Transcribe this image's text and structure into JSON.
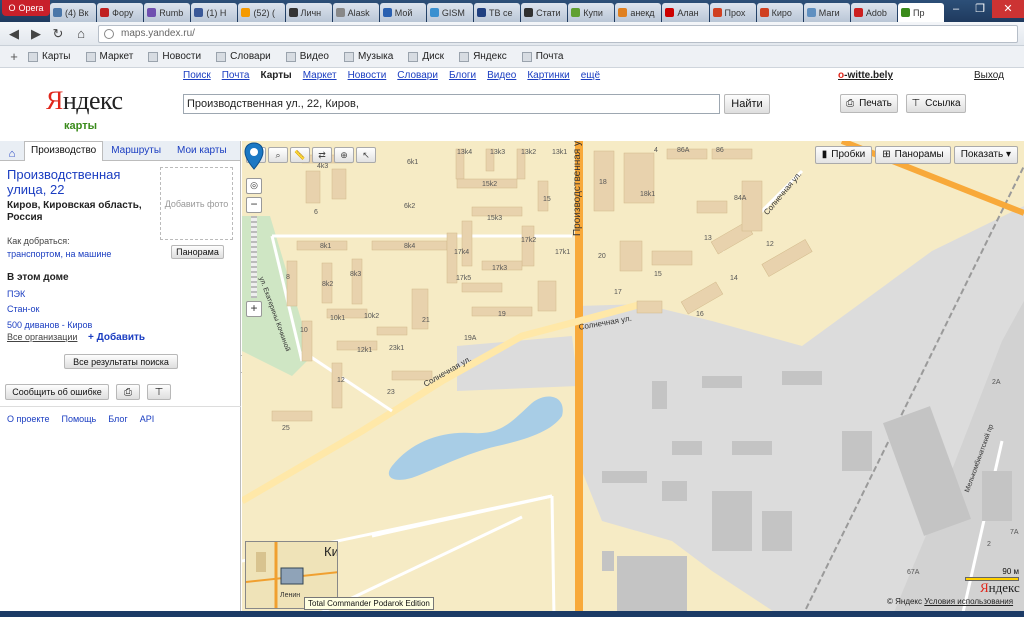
{
  "browser": {
    "name": "Opera",
    "tabs": [
      {
        "label": "(4) Вк",
        "color": "#4a76a8"
      },
      {
        "label": "Фору",
        "color": "#c02020"
      },
      {
        "label": "Rumb",
        "color": "#7050b0"
      },
      {
        "label": "(1) Н",
        "color": "#3b5998"
      },
      {
        "label": "(52) (",
        "color": "#f59a00"
      },
      {
        "label": "Личн",
        "color": "#333333"
      },
      {
        "label": "Alask",
        "color": "#888888"
      },
      {
        "label": "Мой",
        "color": "#2a60b0"
      },
      {
        "label": "GISM",
        "color": "#3a90d0"
      },
      {
        "label": "ТВ се",
        "color": "#204080"
      },
      {
        "label": "Стати",
        "color": "#303030"
      },
      {
        "label": "Купи",
        "color": "#60a030"
      },
      {
        "label": "анекд",
        "color": "#e08020"
      },
      {
        "label": "Алан",
        "color": "#cc0000"
      },
      {
        "label": "Прох",
        "color": "#d04020"
      },
      {
        "label": "Киро",
        "color": "#d04020"
      },
      {
        "label": "Маги",
        "color": "#6090c0"
      },
      {
        "label": "Adob",
        "color": "#cc2020"
      },
      {
        "label": "Пр",
        "color": "#3a8b1b",
        "active": true
      }
    ],
    "url": "maps.yandex.ru/",
    "bookmarks": [
      "Карты",
      "Маркет",
      "Новости",
      "Словари",
      "Видео",
      "Музыка",
      "Диск",
      "Яндекс",
      "Почта"
    ]
  },
  "header": {
    "logo": "Яндекс",
    "logo_sub": "карты",
    "services": [
      "Поиск",
      "Почта",
      "Карты",
      "Маркет",
      "Новости",
      "Словари",
      "Блоги",
      "Видео",
      "Картинки",
      "ещё"
    ],
    "current_service": "Карты",
    "user": "o-witte.bely",
    "logout": "Выход",
    "search_value": "Производственная ул., 22, Киров,",
    "search_button": "Найти",
    "print": "Печать",
    "link": "Ссылка"
  },
  "panel": {
    "tabs": [
      "Производство",
      "Маршруты",
      "Мои карты"
    ],
    "title": "Производственная улица, 22",
    "subtitle": "Киров, Кировская область, Россия",
    "add_photo": "Добавить фото",
    "how_to_get": "Как добраться:",
    "how_to_get_links": "транспортом, на машине",
    "panorama_btn": "Панорама",
    "in_house": "В этом доме",
    "orgs": [
      "ПЭК",
      "Стан-ок",
      "500 диванов - Киров"
    ],
    "all_orgs": "Все организации",
    "add": "+ Добавить",
    "all_results": "Все результаты поиска",
    "report_error": "Сообщить об ошибке",
    "footer": [
      "О проекте",
      "Помощь",
      "Блог",
      "API"
    ]
  },
  "map": {
    "buttons": [
      "Пробки",
      "Панорамы",
      "Показать ▾"
    ],
    "streets": [
      "Производственная ул.",
      "Солнечная ул.",
      "Солнечная ул.",
      "Солнечная ул.",
      "ул. Екатерины Кочкиной",
      "Мелькомбинатский пр"
    ],
    "scale": "90 м",
    "copyright": "© Яндекс",
    "terms": "Условия использования",
    "map_logo": "Яндекс",
    "minimap_label": "Ки",
    "minimap_sub": "Ленин",
    "tooltip": "Total Commander Podarok Edition",
    "house_numbers": [
      "6k1",
      "4k3",
      "13k4",
      "13k3",
      "13k2",
      "13k1",
      "15k2",
      "15",
      "15k3",
      "6k2",
      "6",
      "8k1",
      "8k4",
      "17k4",
      "17k2",
      "17k1",
      "8k3",
      "8",
      "8k2",
      "17k5",
      "17k3",
      "19",
      "21",
      "10k1",
      "10k2",
      "10",
      "12k1",
      "23k1",
      "12",
      "23",
      "19A",
      "25",
      "18",
      "18k1",
      "20",
      "17",
      "15",
      "16",
      "14",
      "13",
      "12",
      "84A",
      "86A",
      "86",
      "4",
      "2A",
      "2",
      "7A",
      "67A"
    ]
  },
  "colors": {
    "accent": "#1a3dc1",
    "brand_red": "#e0261b",
    "road_orange": "#f8a93a",
    "map_bg": "#f6ebc5",
    "water": "#a8cde6",
    "industrial": "#dcdcdc"
  }
}
